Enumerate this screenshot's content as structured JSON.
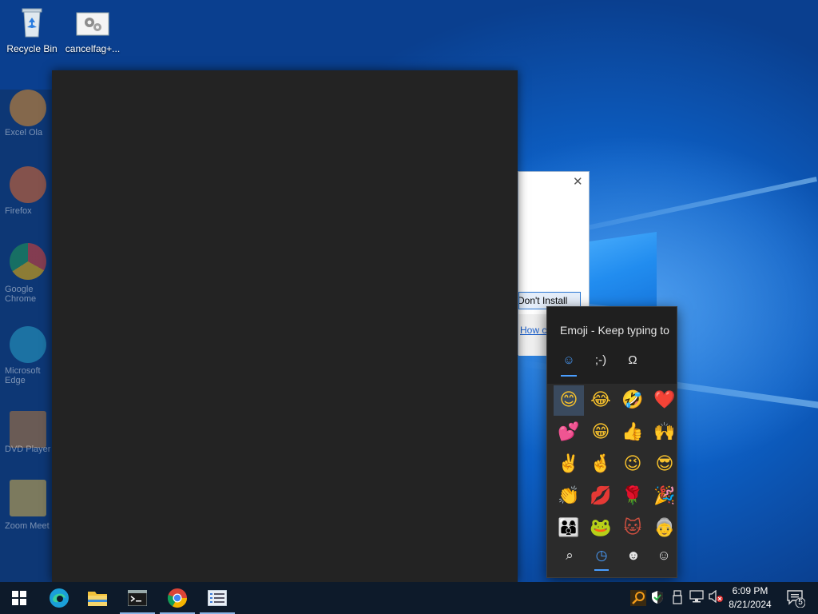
{
  "desktop": {
    "icons": [
      {
        "label": "Recycle Bin",
        "icon": "recycle-bin-icon"
      },
      {
        "label": "cancelfag+...",
        "icon": "settings-file-icon"
      }
    ],
    "ghost_labels": [
      "Excel Ola",
      "Firefox",
      "Google Chrome",
      "Microsoft Edge",
      "DVD Player",
      "Zoom Meet"
    ]
  },
  "dialog": {
    "dont_install_label": "Don't Install",
    "link_text": "How c",
    "close_label": "✕"
  },
  "emoji_panel": {
    "title": "Emoji - Keep typing to",
    "top_tabs": [
      {
        "icon": "smiley-tab-icon",
        "glyph": "☺"
      },
      {
        "icon": "kaomoji-tab-icon",
        "glyph": ";-)"
      },
      {
        "icon": "symbols-tab-icon",
        "glyph": "Ω"
      }
    ],
    "emojis": [
      "😊",
      "😂",
      "🤣",
      "❤️",
      "💕",
      "😁",
      "👍",
      "🙌",
      "✌️",
      "🤞",
      "😉",
      "😎",
      "👏",
      "💋",
      "🌹",
      "🎉",
      "👨‍👩‍👦",
      "🐸",
      "🐱",
      "👵"
    ],
    "emoji_colors": [
      "#f7c12c",
      "#f7c12c",
      "#f7c12c",
      "#e0242c",
      "#e0344c",
      "#f7c12c",
      "#f7c12c",
      "#f7c12c",
      "#f7c12c",
      "#f7c12c",
      "#f7c12c",
      "#f7c12c",
      "#f7c12c",
      "#d0202c",
      "#d0202c",
      "#f7c12c",
      "#e0542c",
      "#6aa82c",
      "#d05040",
      "#c06080"
    ],
    "bottom_tabs": [
      {
        "icon": "search-icon",
        "glyph": "⌕"
      },
      {
        "icon": "recent-clock-icon",
        "glyph": "◷"
      },
      {
        "icon": "smiley-category-icon",
        "glyph": "☻"
      },
      {
        "icon": "people-category-icon",
        "glyph": "☺"
      }
    ]
  },
  "taskbar": {
    "apps": [
      {
        "name": "edge",
        "icon": "edge-icon"
      },
      {
        "name": "file-explorer",
        "icon": "folder-icon"
      },
      {
        "name": "terminal",
        "icon": "terminal-icon"
      },
      {
        "name": "chrome",
        "icon": "chrome-icon"
      },
      {
        "name": "app",
        "icon": "list-app-icon"
      }
    ],
    "time": "6:09 PM",
    "date": "8/21/2024",
    "notification_count": "5"
  }
}
